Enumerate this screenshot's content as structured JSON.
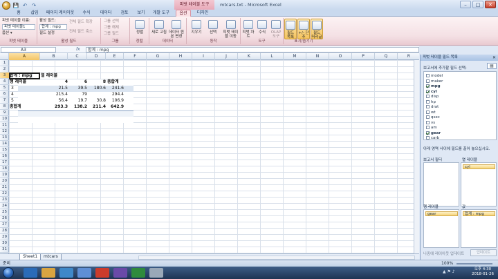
{
  "window": {
    "title": "mtcars.txt - Microsoft Excel",
    "contextual_tab_group": "피벗 테이블 도구"
  },
  "qat": {
    "save": "💾",
    "undo": "↶",
    "redo": "↷"
  },
  "tabs": [
    "홈",
    "삽입",
    "페이지 레이아웃",
    "수식",
    "데이터",
    "검토",
    "보기",
    "개발 도구",
    "옵션",
    "디자인"
  ],
  "active_tab": "옵션",
  "ribbon": {
    "pivot_name_label": "피벗 테이블 이름:",
    "pivot_name_value": "피벗 테이블1",
    "options_btn": "옵션 ▾",
    "group_pivot": "피벗 테이블",
    "active_field_label": "활성 필드:",
    "active_field_value": "합계 : mpg",
    "field_settings": "필드 설정",
    "expand_field": "전체 필드 확장",
    "collapse_field": "전체 필드 축소",
    "group_active_field": "활성 필드",
    "group_selection": "그룹 선택",
    "ungroup": "그룹 해제",
    "group_field": "그룹 필드",
    "group_group": "그룹",
    "sort": "정렬",
    "group_sort": "정렬",
    "refresh": "새로 고침",
    "change_source": "데이터 원본 변경",
    "group_data": "데이터",
    "clear": "지우기",
    "select": "선택",
    "move_pivot": "피벗 테이블 이동",
    "group_actions": "동작",
    "pivot_chart": "피벗 차트",
    "formulas": "수식",
    "olap_tools": "OLAP 도구",
    "group_tools": "도구",
    "field_list": "필드 목록",
    "plus_minus": "+/- 단추",
    "field_headers": "필드 머리글",
    "group_show_hide": "표시/숨기기"
  },
  "formula_bar": {
    "name_box": "A3",
    "fx": "fx",
    "content": "합계 : mpg"
  },
  "columns": [
    "A",
    "B",
    "C",
    "D",
    "E",
    "F",
    "G",
    "H",
    "I",
    "J",
    "K",
    "L",
    "M",
    "N",
    "O",
    "P",
    "Q",
    "R"
  ],
  "rows": [
    "1",
    "2",
    "3",
    "4",
    "5",
    "6",
    "7",
    "8",
    "9",
    "10",
    "11",
    "12",
    "13",
    "14",
    "15",
    "16",
    "17",
    "18",
    "19",
    "20",
    "21",
    "22",
    "23",
    "24",
    "25",
    "26",
    "27",
    "28",
    "29",
    "30",
    "31"
  ],
  "pivot": {
    "corner_label": "합계 : mpg",
    "col_labels": "열 레이블",
    "row_labels": "행 레이블",
    "col_headers": [
      "4",
      "6",
      "8"
    ],
    "grand_total_label": "총합계",
    "rows": [
      {
        "label": "3",
        "values": [
          "21.5",
          "39.5",
          "180.6",
          "241.6"
        ]
      },
      {
        "label": "4",
        "values": [
          "215.4",
          "79",
          "",
          "294.4"
        ]
      },
      {
        "label": "5",
        "values": [
          "56.4",
          "19.7",
          "30.8",
          "106.9"
        ]
      }
    ],
    "totals": [
      "293.3",
      "138.2",
      "211.4",
      "642.9"
    ]
  },
  "sheet_tabs": [
    "Sheet1",
    "mtcars"
  ],
  "status": {
    "ready": "준비",
    "zoom": "100%"
  },
  "task_pane": {
    "title": "피벗 테이블 필드 목록",
    "prompt": "보고서에 추가할 필드 선택:",
    "fields": [
      {
        "name": "model",
        "checked": false
      },
      {
        "name": "maker",
        "checked": false
      },
      {
        "name": "mpg",
        "checked": true
      },
      {
        "name": "cyl",
        "checked": true
      },
      {
        "name": "disp",
        "checked": false
      },
      {
        "name": "hp",
        "checked": false
      },
      {
        "name": "drat",
        "checked": false
      },
      {
        "name": "wt",
        "checked": false
      },
      {
        "name": "qsec",
        "checked": false
      },
      {
        "name": "vs",
        "checked": false
      },
      {
        "name": "am",
        "checked": false
      },
      {
        "name": "gear",
        "checked": true
      },
      {
        "name": "carb",
        "checked": false
      }
    ],
    "drag_prompt": "아래 영역 사이에 필드를 끌어 놓으십시오.",
    "report_filter": "보고서 필터",
    "column_labels": "열 레이블",
    "row_labels": "행 레이블",
    "values": "값",
    "column_chip": "cyl",
    "row_chip": "gear",
    "value_chip": "합계 : mpg",
    "defer": "나중에 레이아웃 업데이트",
    "update": "업데이트"
  },
  "taskbar": {
    "time": "오후 4:30",
    "date": "2018-01-26"
  }
}
